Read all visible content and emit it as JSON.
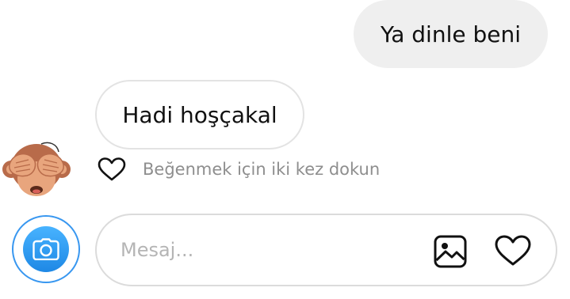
{
  "thread": {
    "messages": [
      {
        "direction": "sent",
        "text": "Ya dinle beni"
      },
      {
        "direction": "received",
        "text": "Hadi hoşçakal"
      }
    ],
    "like_hint": "Beğenmek için iki kez dokun",
    "sender_avatar_icon": "see-no-evil-monkey-emoji"
  },
  "composer": {
    "placeholder": "Mesaj...",
    "value": "",
    "camera_icon": "camera-icon",
    "gallery_icon": "image-gallery-icon",
    "like_icon": "heart-outline-icon"
  },
  "colors": {
    "sent_bubble_bg": "#efefef",
    "received_bubble_border": "#e3e3e3",
    "camera_accent": "#3897f0",
    "hint_text": "#8e8e8e",
    "placeholder_text": "#b5b5b5"
  }
}
